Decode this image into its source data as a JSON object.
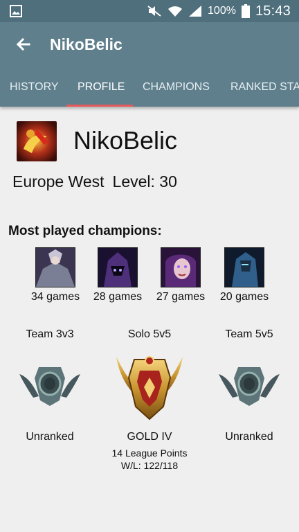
{
  "status_bar": {
    "battery": "100%",
    "time": "15:43"
  },
  "toolbar": {
    "title": "NikoBelic"
  },
  "tabs": [
    {
      "label": "HISTORY"
    },
    {
      "label": "PROFILE"
    },
    {
      "label": "CHAMPIONS"
    },
    {
      "label": "RANKED STATS"
    }
  ],
  "profile": {
    "name": "NikoBelic",
    "region": "Europe West",
    "level": "Level: 30"
  },
  "most_played": {
    "title": "Most played champions:",
    "champions": [
      {
        "games": "34 games"
      },
      {
        "games": "28 games"
      },
      {
        "games": "27 games"
      },
      {
        "games": "20 games"
      }
    ]
  },
  "ranked": [
    {
      "queue": "Team 3v3",
      "tier": "Unranked"
    },
    {
      "queue": "Solo 5v5",
      "tier": "GOLD IV",
      "league_points": "14 League Points",
      "wl": "W/L: 122/118"
    },
    {
      "queue": "Team 5v5",
      "tier": "Unranked"
    }
  ],
  "colors": {
    "status_bar": "#4f6f7c",
    "toolbar": "#5f7f8d",
    "tab_indicator": "#e65a5a"
  }
}
